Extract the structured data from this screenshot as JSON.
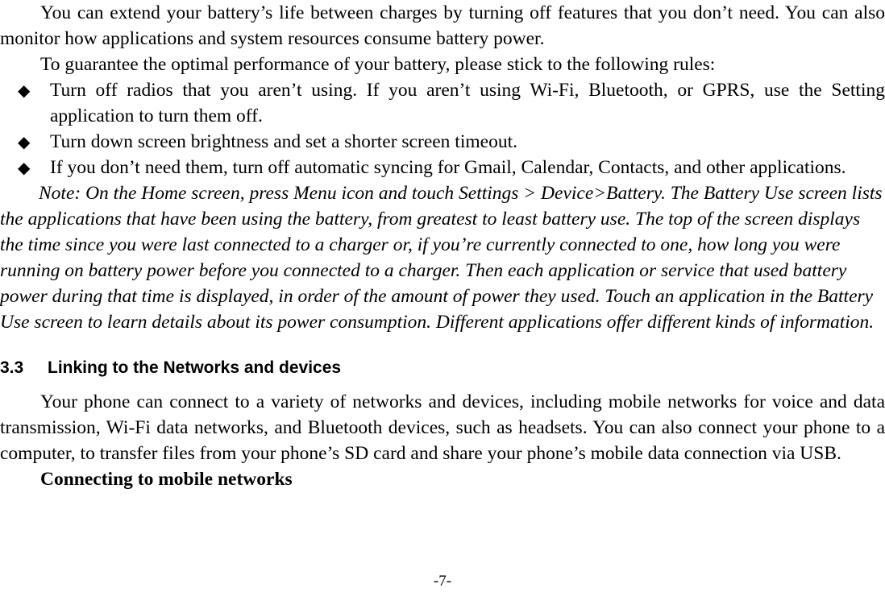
{
  "document": {
    "page_number_label": "-7-",
    "bullet_glyph": "◆",
    "text_color": "#000000",
    "background_color": "#ffffff"
  },
  "content": {
    "intro_paragraph": "You can extend your battery’s life between charges by turning off features that you don’t need. You can also monitor how applications and system resources consume battery power.",
    "rules_lead_in": "To guarantee the optimal performance of your battery, please stick to the following rules:",
    "bullets": [
      "Turn off radios that you aren’t using. If you aren’t using Wi-Fi, Bluetooth, or GPRS, use the Setting application to turn them off.",
      "Turn down screen brightness and set a shorter screen timeout.",
      "If you don’t need them, turn off automatic syncing for Gmail, Calendar, Contacts, and other applications."
    ],
    "note_paragraph": "Note: On the Home screen, press Menu icon and touch Settings > Device>Battery. The Battery Use screen lists the applications that have been using the battery, from greatest to least battery use. The top of the screen displays the time since you were last connected to a charger or, if you’re currently connected to one, how long you were running on battery power before you connected to a charger. Then each application or service that used battery power during that time is displayed, in order of the amount of power they used. Touch an application in the Battery Use screen to learn details about its power consumption. Different applications offer different kinds of information.",
    "section": {
      "number": "3.3",
      "title": "Linking to the Networks and devices"
    },
    "section_paragraph": "Your phone can connect to a variety of networks and devices, including mobile networks for voice and data transmission, Wi-Fi data networks, and Bluetooth devices, such as headsets. You can also connect your phone to a computer, to transfer files from your phone’s SD card and share your phone’s mobile data connection via USB.",
    "sub_heading": "Connecting to mobile networks"
  }
}
